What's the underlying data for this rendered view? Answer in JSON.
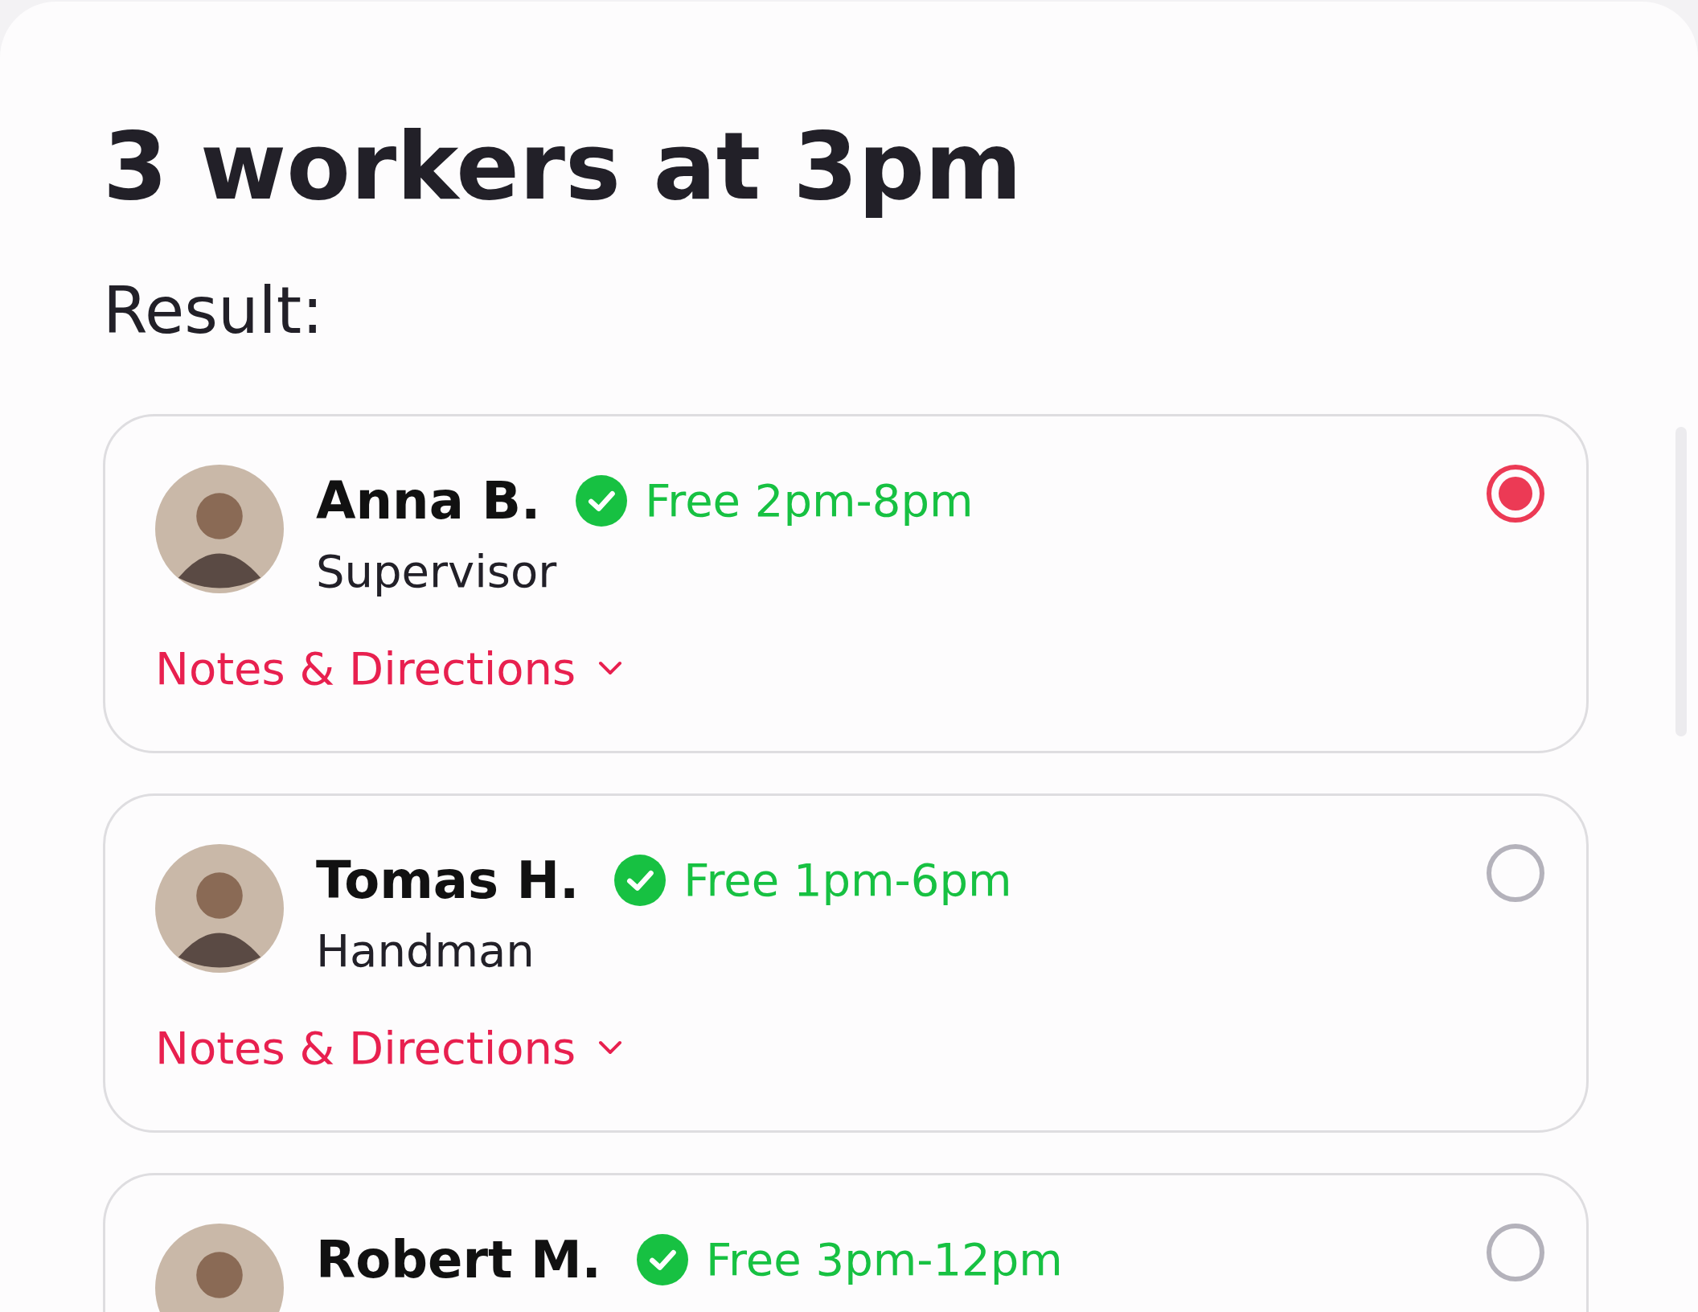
{
  "title": "3 workers at 3pm",
  "subtitle": "Result:",
  "workers": [
    {
      "name": "Anna B.",
      "availability": "Free 2pm-8pm",
      "role": "Supervisor",
      "notes_link": "Notes & Directions",
      "selected": true
    },
    {
      "name": "Tomas H.",
      "availability": "Free 1pm-6pm",
      "role": "Handman",
      "notes_link": "Notes & Directions",
      "selected": false
    },
    {
      "name": "Robert M.",
      "availability": "Free 3pm-12pm",
      "selected": false
    }
  ]
}
